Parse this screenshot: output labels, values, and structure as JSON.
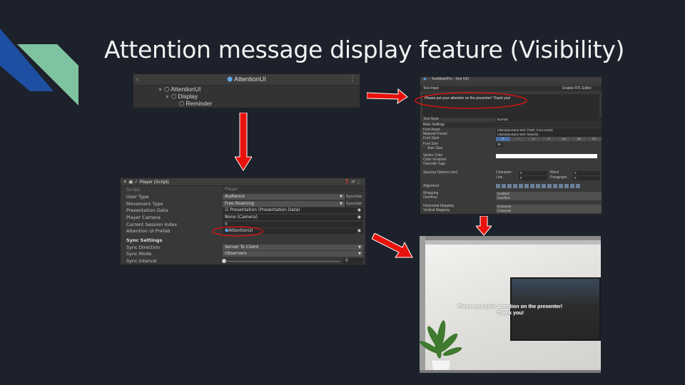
{
  "slide": {
    "title": "Attention message display feature (Visibility)",
    "accent_colors": {
      "dark_blue": "#1e4fa3",
      "mint": "#7fc4a0",
      "arrow_red": "#e8120c"
    }
  },
  "hierarchy": {
    "header_title": "AttentionUI",
    "items": [
      {
        "label": "AttentionUI",
        "icon": "cube-icon"
      },
      {
        "label": "Display",
        "icon": "cube-icon"
      },
      {
        "label": "Reminder",
        "icon": "cube-icon"
      }
    ]
  },
  "tmp_inspector": {
    "component_title": "TextMeshPro - Text (UI)",
    "text_input_label": "Text Input",
    "rtl_label": "Enable RTL Editor",
    "text_value": "Please put your attention on the presenter! Thank you!",
    "rows": {
      "text_style": {
        "label": "Text Style",
        "value": "Normal"
      },
      "main_settings": "Main Settings",
      "font_asset": {
        "label": "Font Asset",
        "value": "LiberationSans SDF (TMP_Font Asset)"
      },
      "material_preset": {
        "label": "Material Preset",
        "value": "LiberationSans SDF Material"
      },
      "font_style": {
        "label": "Font Style",
        "buttons": [
          "B",
          "I",
          "U",
          "S",
          "ab",
          "AB",
          "SC"
        ]
      },
      "font_size": {
        "label": "Font Size",
        "value": "35"
      },
      "auto_size": {
        "label": "Auto Size"
      },
      "vertex_color": {
        "label": "Vertex Color"
      },
      "color_gradient": {
        "label": "Color Gradient"
      },
      "override_tags": {
        "label": "Override Tags"
      },
      "spacing": {
        "label": "Spacing Options (em)",
        "character": "Character",
        "character_val": "0",
        "word": "Word",
        "word_val": "0",
        "line": "Line",
        "line_val": "0",
        "paragraph": "Paragraph",
        "paragraph_val": "0"
      },
      "alignment": {
        "label": "Alignment"
      },
      "wrapping": {
        "label": "Wrapping",
        "value": "Enabled"
      },
      "overflow": {
        "label": "Overflow",
        "value": "Overflow"
      },
      "horizontal_mapping": {
        "label": "Horizontal Mapping",
        "value": "Character"
      },
      "vertical_mapping": {
        "label": "Vertical Mapping",
        "value": "Character"
      }
    }
  },
  "player_inspector": {
    "component_title": "Player (Script)",
    "rows": [
      {
        "label": "Script",
        "value": "Player",
        "dropdown": false,
        "syncvar": ""
      },
      {
        "label": "User Type",
        "value": "Audience",
        "dropdown": true,
        "syncvar": "SyncVar"
      },
      {
        "label": "Movement Type",
        "value": "Free Roaming",
        "dropdown": true,
        "syncvar": "SyncVar"
      },
      {
        "label": "Presentation Data",
        "value": "Presentation (Presentation Data)",
        "dropdown": false,
        "syncvar": ""
      },
      {
        "label": "Player Camera",
        "value": "None (Camera)",
        "dropdown": false,
        "syncvar": ""
      },
      {
        "label": "Current Session Index",
        "value": "0",
        "dropdown": false,
        "syncvar": ""
      },
      {
        "label": "Attention UI Prefab",
        "value": "AttentionUI",
        "dropdown": false,
        "syncvar": ""
      }
    ],
    "sync_settings_label": "Sync Settings",
    "sync_rows": [
      {
        "label": "Sync Direction",
        "value": "Server To Client"
      },
      {
        "label": "Sync Mode",
        "value": "Observers"
      },
      {
        "label": "Sync Interval",
        "value": "0"
      }
    ]
  },
  "scene": {
    "message": "Please put your attention on the presenter! Thank you!"
  }
}
